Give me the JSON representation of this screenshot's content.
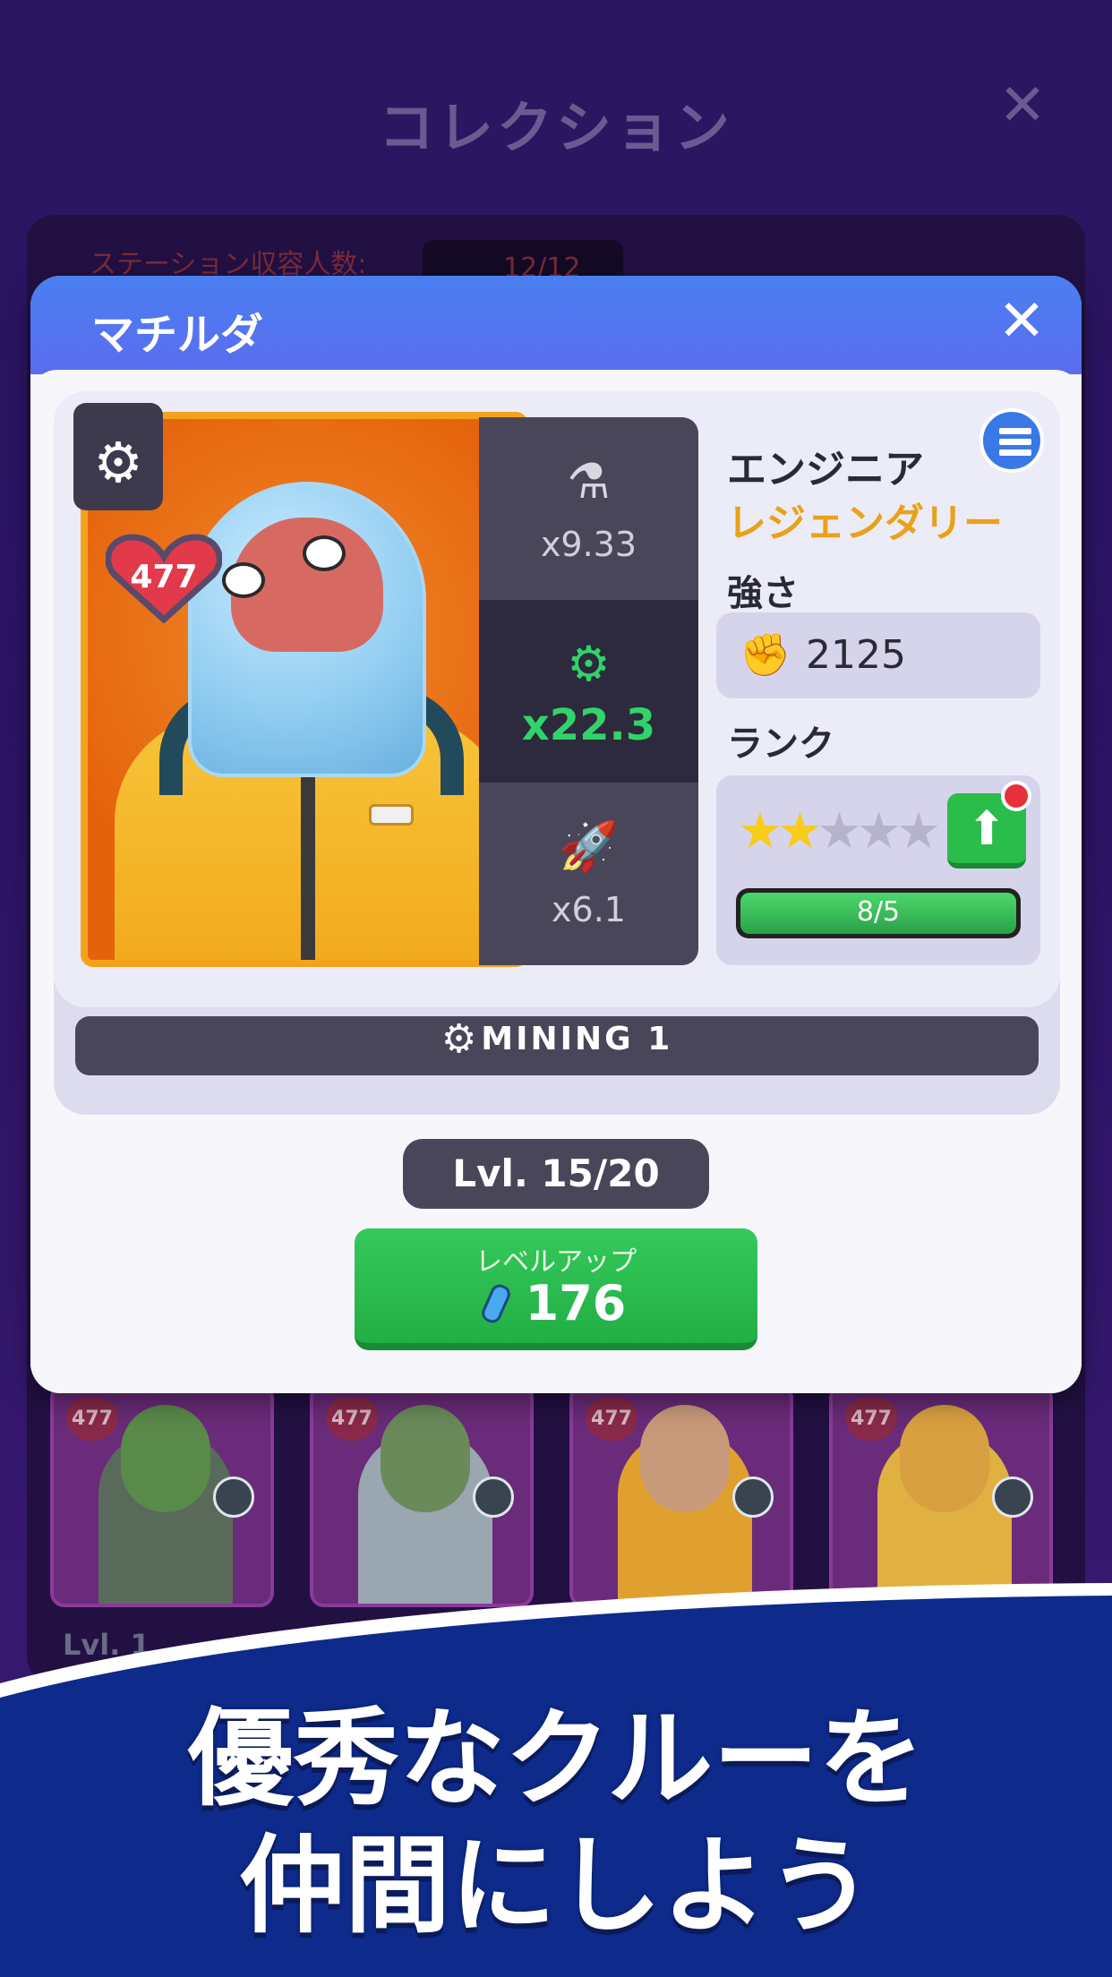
{
  "background": {
    "title": "コレクション",
    "close_glyph": "✕",
    "capacity_label": "ステーション収容人数:",
    "capacity_value": "12/12",
    "crew_cards": [
      {
        "hearts": "477",
        "skin": "#5a8a4a",
        "suit": "#5a6a5a"
      },
      {
        "hearts": "477",
        "skin": "#6a8a5a",
        "suit": "#9aa6b0"
      },
      {
        "hearts": "477",
        "skin": "#c89a7a",
        "suit": "#e0a030"
      },
      {
        "hearts": "477",
        "skin": "#d8a040",
        "suit": "#e0b040"
      }
    ],
    "first_card_level": "Lvl. 1"
  },
  "modal": {
    "title": "マチルダ",
    "close_glyph": "✕",
    "class_icon": "gears-icon",
    "hearts": "477",
    "multipliers": [
      {
        "icon": "flask-icon",
        "glyph": "⚗",
        "value": "x9.33",
        "active": false
      },
      {
        "icon": "gears-icon",
        "glyph": "⚙",
        "value": "x22.3",
        "active": true
      },
      {
        "icon": "rocket-icon",
        "glyph": "🚀",
        "value": "x6.1",
        "active": false
      }
    ],
    "role": "エンジニア",
    "rarity": "レジェンダリー",
    "strength_label": "強さ",
    "strength_value": "2125",
    "rank_label": "ランク",
    "rank_stars": 2,
    "rank_stars_max": 5,
    "rank_progress_text": "8/5",
    "rank_progress": 1.0,
    "mining_label": "MINING 1",
    "level": "Lvl. 15/20",
    "levelup_label": "レベルアップ",
    "levelup_cost": "176"
  },
  "promo": {
    "line1": "優秀なクルーを",
    "line2": "仲間にしよう"
  },
  "colors": {
    "accent_green": "#2bbd4b",
    "rarity_gold": "#e8a21a",
    "header_blue": "#4a7ff0",
    "promo_navy": "#0e2a8a"
  }
}
